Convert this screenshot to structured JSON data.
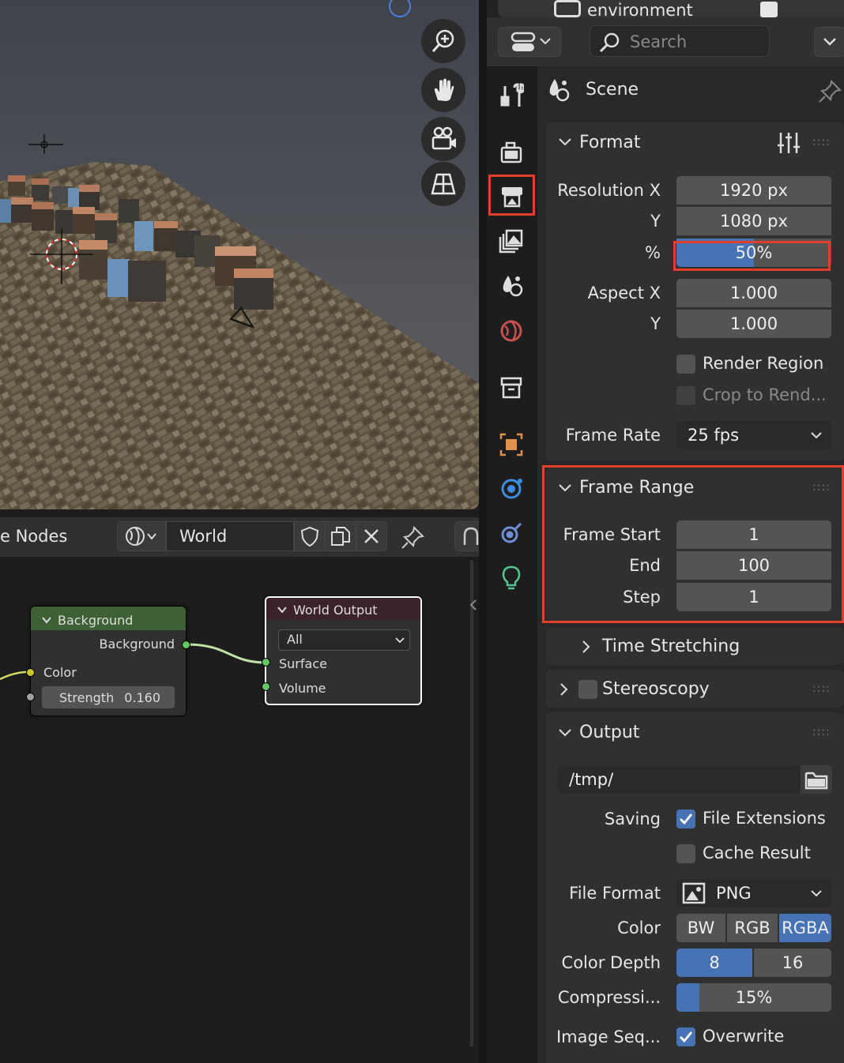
{
  "outliner_strip": {
    "collection_label": "environment"
  },
  "search": {
    "placeholder": "Search"
  },
  "context": {
    "label": "Scene"
  },
  "format": {
    "title": "Format",
    "resolution_x_label": "Resolution X",
    "resolution_x": "1920 px",
    "y_label": "Y",
    "resolution_y": "1080 px",
    "percent_label": "%",
    "percent": "50%",
    "percent_fraction": 0.5,
    "aspect_x_label": "Aspect X",
    "aspect_x": "1.000",
    "aspect_y_label": "Y",
    "aspect_y": "1.000",
    "render_region": "Render Region",
    "crop": "Crop to Rend...",
    "frame_rate_label": "Frame Rate",
    "frame_rate": "25 fps"
  },
  "frame_range": {
    "title": "Frame Range",
    "start_label": "Frame Start",
    "start": "1",
    "end_label": "End",
    "end": "100",
    "step_label": "Step",
    "step": "1"
  },
  "time_stretching": {
    "title": "Time Stretching"
  },
  "stereoscopy": {
    "title": "Stereoscopy"
  },
  "output": {
    "title": "Output",
    "path": "/tmp/",
    "saving_label": "Saving",
    "file_extensions": "File Extensions",
    "cache_result": "Cache Result",
    "file_format_label": "File Format",
    "file_format": "PNG",
    "color_label": "Color",
    "color_options": [
      "BW",
      "RGB",
      "RGBA"
    ],
    "color_selected": "RGBA",
    "depth_label": "Color Depth",
    "depth_options": [
      "8",
      "16"
    ],
    "depth_selected": "8",
    "compression_label": "Compressi...",
    "compression": "15%",
    "compression_fraction": 0.15,
    "image_seq_label": "Image Seq...",
    "overwrite": "Overwrite"
  },
  "node_editor": {
    "editor_title": "e Nodes",
    "world_name": "World",
    "background_node": {
      "title": "Background",
      "out_label": "Background",
      "color_label": "Color",
      "strength_label": "Strength",
      "strength": "0.160"
    },
    "world_output_node": {
      "title": "World Output",
      "target": "All",
      "surface": "Surface",
      "volume": "Volume"
    }
  },
  "colors": {
    "accent": "#4772b3",
    "highlight": "#e0402b",
    "node_bg_header": "#3d6135",
    "node_out_header": "#3b2329"
  }
}
